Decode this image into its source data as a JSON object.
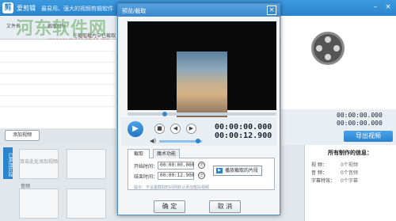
{
  "window": {
    "app_name": "爱剪辑",
    "slogan": "最易用、强大的视频剪辑软件",
    "logo": "剪"
  },
  "watermark": {
    "text": "河东软件网",
    "url": "www.pc0359.cn"
  },
  "toolbar": {
    "item_files": "文件名",
    "item_dur": "截取时长",
    "item_clip": "在截取截片中已截取"
  },
  "left": {
    "add_video": "添加视频",
    "vertical_tab": "已添加片段",
    "clip_hint": "双击此处添加视频",
    "track": "音频"
  },
  "right": {
    "time1": "00:00:00.000",
    "time2": "00:00:00.000",
    "export_label": "导出视频"
  },
  "info": {
    "title": "所有制作的信息：",
    "rows": [
      {
        "label": "视 频：",
        "value": "0个视频"
      },
      {
        "label": "音 频：",
        "value": "0个音频"
      },
      {
        "label": "字幕特效：",
        "value": "0个字幕"
      }
    ]
  },
  "dialog": {
    "title": "预览/截取",
    "close": "×",
    "current_time": "00:00:00.000",
    "total_time": "00:00:12.900",
    "tabs": [
      "截取",
      "魔术功能"
    ],
    "start_label": "开始时间：",
    "start_value": "00:00:00.000",
    "end_label": "结束时间：",
    "end_value": "00:00:12.900",
    "play_cut": "播放截取的片段",
    "hint": "提示：不设置截取时间则默认添加整段视频",
    "ok": "确 定",
    "cancel": "取 消"
  },
  "icons": {
    "play": "play-icon",
    "stop": "stop-icon",
    "prev": "prev-frame-icon",
    "next": "next-frame-icon"
  },
  "colors": {
    "accent": "#2b84cc"
  }
}
